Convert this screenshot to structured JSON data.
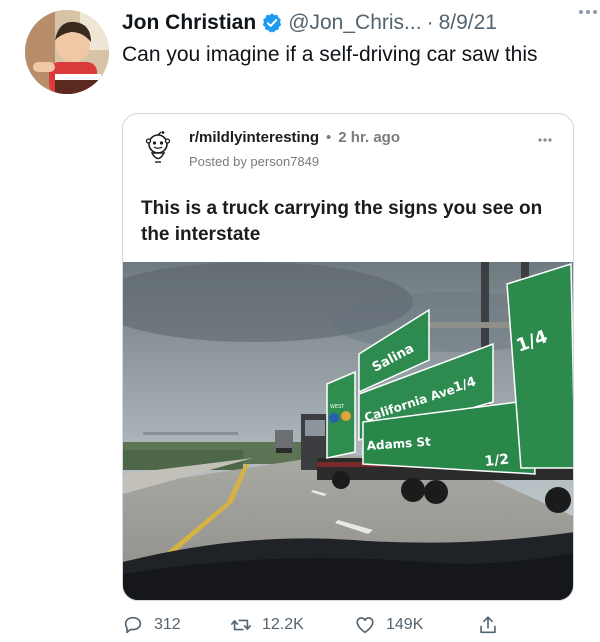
{
  "tweet": {
    "display_name": "Jon Christian",
    "handle": "@Jon_Chris...",
    "separator": "·",
    "date": "8/9/21",
    "text": "Can you imagine if a self-driving car saw this",
    "avatar_icon": "child-photo-avatar",
    "verified_color": "#1d9bf0"
  },
  "reddit_card": {
    "subreddit": "r/mildlyinteresting",
    "separator": "•",
    "age": "2 hr. ago",
    "posted_by": "Posted by person7849",
    "title": "This is a truck carrying the signs you see on the interstate",
    "photo": {
      "signs": {
        "salina": "Salina",
        "california": "California Ave",
        "adams": "Adams St",
        "quarter_1": "1/4",
        "quarter_2": "1/4",
        "half": "1/2",
        "route_label": "WEST"
      },
      "sign_color": "#2e8b4f"
    }
  },
  "actions": {
    "replies": "312",
    "retweets": "12.2K",
    "likes": "149K",
    "icon_color": "#536471"
  }
}
